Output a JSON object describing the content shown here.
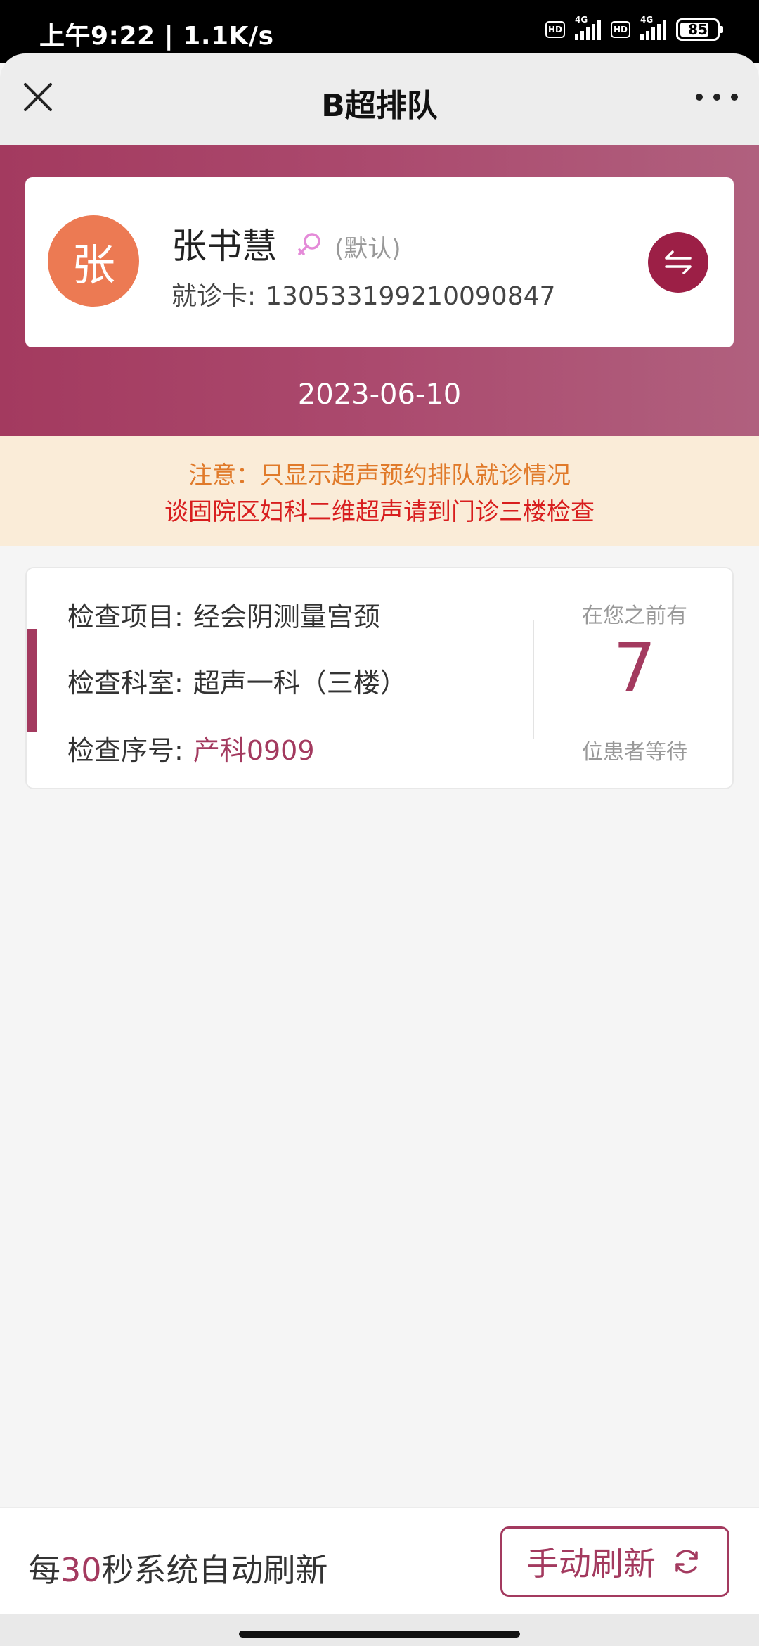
{
  "status_bar": {
    "time": "上午9:22",
    "network_speed": "1.1K/s",
    "sim1": {
      "hd": "HD",
      "type": "4G"
    },
    "sim2": {
      "hd": "HD",
      "type": "4G"
    },
    "battery": "85"
  },
  "nav": {
    "title": "B超排队",
    "close_icon": "close-icon",
    "more_icon": "more-dots-icon"
  },
  "patient": {
    "avatar_char": "张",
    "name": "张书慧",
    "gender_icon": "female-icon",
    "default_tag": "(默认)",
    "card_label": "就诊卡:",
    "card_number": "130533199210090847",
    "switch_icon": "switch-arrows-icon"
  },
  "date": "2023-06-10",
  "notice": {
    "line1": "注意：只显示超声预约排队就诊情况",
    "line2": "谈固院区妇科二维超声请到门诊三楼检查"
  },
  "queue": {
    "rows": [
      {
        "label": "检查项目:",
        "value": "经会阴测量宫颈"
      },
      {
        "label": "检查科室:",
        "value": "超声一科（三楼）"
      },
      {
        "label": "检查序号:",
        "value": "产科0909"
      }
    ],
    "wait_prefix": "在您之前有",
    "wait_count": "7",
    "wait_suffix": "位患者等待"
  },
  "footer": {
    "auto_prefix": "每",
    "auto_interval": "30",
    "auto_suffix": "秒系统自动刷新",
    "refresh_label": "手动刷新",
    "refresh_icon": "refresh-icon"
  },
  "colors": {
    "accent": "#a33a5f",
    "avatar": "#ec7a53",
    "notice_bg": "#faecd8",
    "notice_orange": "#e07a2a",
    "notice_red": "#d81e1e"
  }
}
